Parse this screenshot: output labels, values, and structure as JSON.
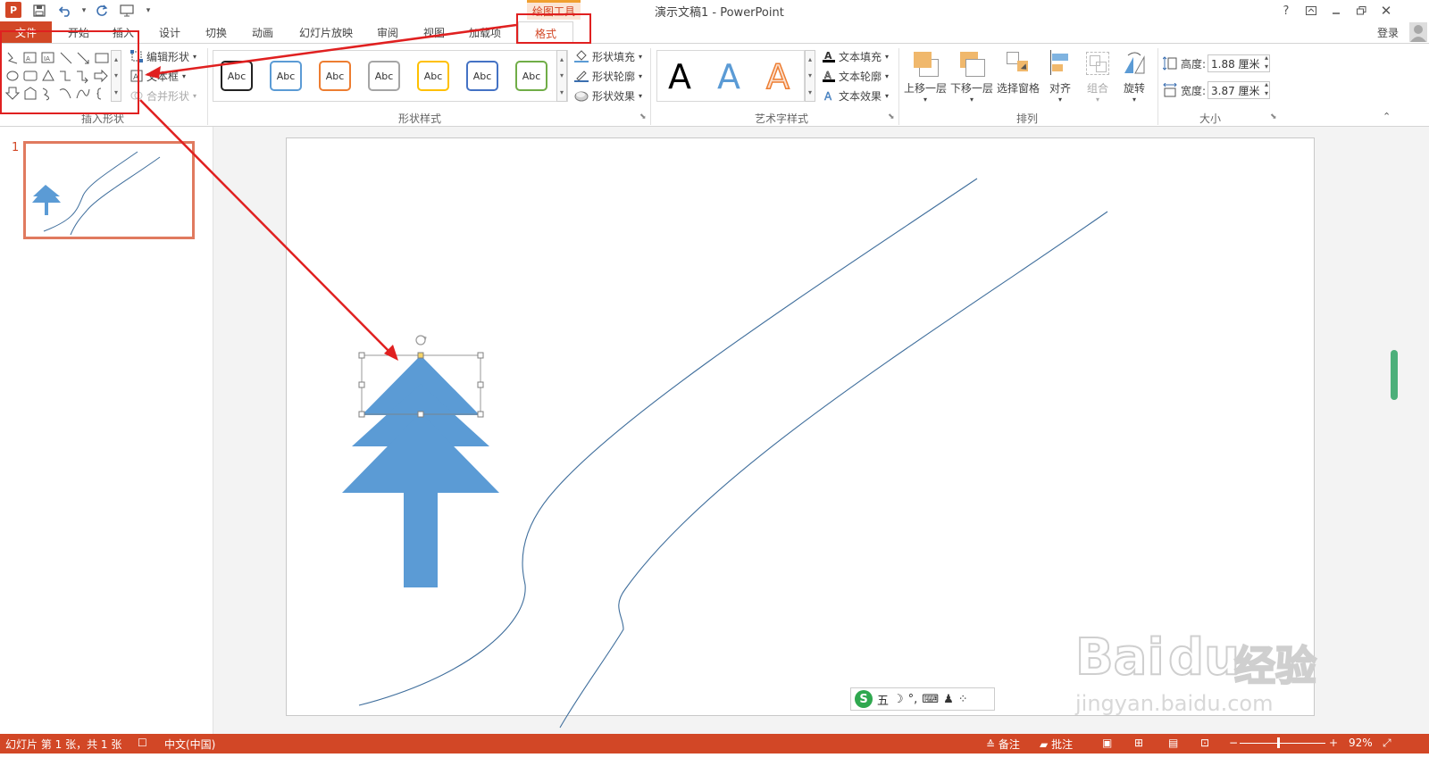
{
  "window": {
    "title": "演示文稿1 - PowerPoint",
    "contextual_tab_group": "绘图工具",
    "help": "?",
    "login": "登录"
  },
  "tabs": [
    {
      "label": "文件"
    },
    {
      "label": "开始"
    },
    {
      "label": "插入"
    },
    {
      "label": "设计"
    },
    {
      "label": "切换"
    },
    {
      "label": "动画"
    },
    {
      "label": "幻灯片放映"
    },
    {
      "label": "审阅"
    },
    {
      "label": "视图"
    },
    {
      "label": "加载项"
    },
    {
      "label": "格式"
    }
  ],
  "ribbon": {
    "insert_shapes": {
      "label": "插入形状",
      "edit_shape": "编辑形状",
      "text_box": "文本框",
      "merge_shapes": "合并形状"
    },
    "shape_styles": {
      "label": "形状样式",
      "preset_label": "Abc",
      "fill": "形状填充",
      "outline": "形状轮廓",
      "effects": "形状效果",
      "preset_colors": [
        "#222222",
        "#5b9bd5",
        "#ed7d31",
        "#a5a5a5",
        "#ffc000",
        "#4472c4",
        "#70ad47"
      ]
    },
    "wordart_styles": {
      "label": "艺术字样式",
      "glyph": "A",
      "text_fill": "文本填充",
      "text_outline": "文本轮廓",
      "text_effects": "文本效果"
    },
    "arrange": {
      "label": "排列",
      "bring_forward": "上移一层",
      "send_backward": "下移一层",
      "selection_pane": "选择窗格",
      "align": "对齐",
      "group": "组合",
      "rotate": "旋转"
    },
    "size": {
      "label": "大小",
      "height_label": "高度:",
      "height_value": "1.88 厘米",
      "width_label": "宽度:",
      "width_value": "3.87 厘米"
    }
  },
  "thumbnails": {
    "slide_number": "1"
  },
  "ime_bar": {
    "mode": "五"
  },
  "status_bar": {
    "slide_info": "幻灯片 第 1 张，共 1 张",
    "language": "中文(中国)",
    "notes": "备注",
    "comments": "批注",
    "zoom": "92%"
  },
  "watermark": {
    "brand_main": "Bai",
    "brand_paw": "du",
    "brand_cn": "经验",
    "url": "jingyan.baidu.com"
  },
  "colors": {
    "accent": "#d24726",
    "tree": "#5b9bd5",
    "road_line": "#3f6e9c",
    "annotation_red": "#e02020"
  }
}
